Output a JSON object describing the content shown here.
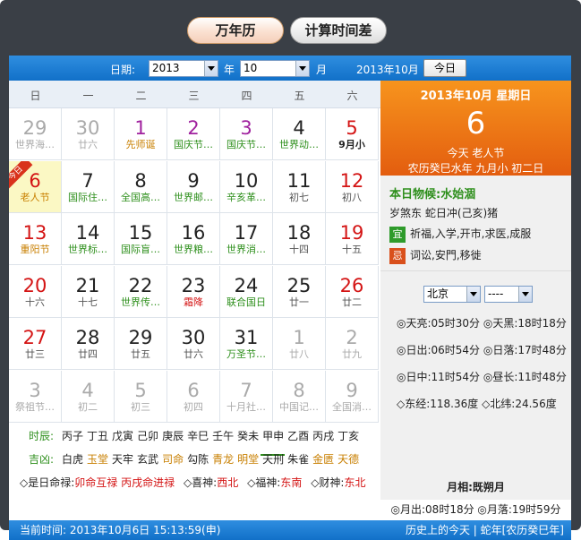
{
  "tabs": {
    "wannianli": "万年历",
    "jisuan": "计算时间差"
  },
  "toolbar": {
    "date_label": "日期:",
    "year_value": "2013",
    "year_unit": "年",
    "month_value": "10",
    "month_unit": "月",
    "current_label": "2013年10月",
    "today_button": "今日"
  },
  "weekdays": [
    "日",
    "一",
    "二",
    "三",
    "四",
    "五",
    "六"
  ],
  "rows": [
    [
      {
        "n": "29",
        "s": "世界海…",
        "c": "dim"
      },
      {
        "n": "30",
        "s": "廿六",
        "c": "dim"
      },
      {
        "n": "1",
        "s": "先师诞",
        "c": "fest",
        "red": 1
      },
      {
        "n": "2",
        "s": "国庆节…",
        "c": "nrm",
        "red": 1
      },
      {
        "n": "3",
        "s": "国庆节…",
        "c": "nrm",
        "red": 1
      },
      {
        "n": "4",
        "s": "世界动…",
        "c": "nrm"
      },
      {
        "n": "5",
        "s": "9月小",
        "c": "wkd bold"
      }
    ],
    [
      {
        "n": "6",
        "s": "老人节",
        "c": "wkd today fest"
      },
      {
        "n": "7",
        "s": "国际住…",
        "c": "nrm"
      },
      {
        "n": "8",
        "s": "全国高…",
        "c": "nrm"
      },
      {
        "n": "9",
        "s": "世界邮…",
        "c": "nrm"
      },
      {
        "n": "10",
        "s": "辛亥革…",
        "c": "nrm"
      },
      {
        "n": "11",
        "s": "初七",
        "c": "nrm lunar"
      },
      {
        "n": "12",
        "s": "初八",
        "c": "wkd lunar"
      }
    ],
    [
      {
        "n": "13",
        "s": "重阳节",
        "c": "wkd fest"
      },
      {
        "n": "14",
        "s": "世界标…",
        "c": "nrm"
      },
      {
        "n": "15",
        "s": "国际盲…",
        "c": "nrm"
      },
      {
        "n": "16",
        "s": "世界粮…",
        "c": "nrm"
      },
      {
        "n": "17",
        "s": "世界消…",
        "c": "nrm"
      },
      {
        "n": "18",
        "s": "十四",
        "c": "nrm lunar"
      },
      {
        "n": "19",
        "s": "十五",
        "c": "wkd lunar"
      }
    ],
    [
      {
        "n": "20",
        "s": "十六",
        "c": "wkd lunar"
      },
      {
        "n": "21",
        "s": "十七",
        "c": "nrm lunar"
      },
      {
        "n": "22",
        "s": "世界传…",
        "c": "nrm"
      },
      {
        "n": "23",
        "s": "霜降",
        "c": "nrm red"
      },
      {
        "n": "24",
        "s": "联合国日",
        "c": "nrm"
      },
      {
        "n": "25",
        "s": "廿一",
        "c": "nrm lunar"
      },
      {
        "n": "26",
        "s": "廿二",
        "c": "wkd lunar"
      }
    ],
    [
      {
        "n": "27",
        "s": "廿三",
        "c": "wkd lunar"
      },
      {
        "n": "28",
        "s": "廿四",
        "c": "nrm lunar"
      },
      {
        "n": "29",
        "s": "廿五",
        "c": "nrm lunar"
      },
      {
        "n": "30",
        "s": "廿六",
        "c": "nrm lunar"
      },
      {
        "n": "31",
        "s": "万圣节…",
        "c": "nrm"
      },
      {
        "n": "1",
        "s": "廿八",
        "c": "dim"
      },
      {
        "n": "2",
        "s": "廿九",
        "c": "dim"
      }
    ],
    [
      {
        "n": "3",
        "s": "祭祖节…",
        "c": "dim"
      },
      {
        "n": "4",
        "s": "初二",
        "c": "dim"
      },
      {
        "n": "5",
        "s": "初三",
        "c": "dim"
      },
      {
        "n": "6",
        "s": "初四",
        "c": "dim"
      },
      {
        "n": "7",
        "s": "十月社…",
        "c": "dim"
      },
      {
        "n": "8",
        "s": "中国记…",
        "c": "dim"
      },
      {
        "n": "9",
        "s": "全国消…",
        "c": "dim"
      }
    ]
  ],
  "today_ribbon": "今日",
  "shichen": {
    "label": "时辰:",
    "items": [
      "丙子",
      "丁丑",
      "戊寅",
      "己卯",
      "庚辰",
      "辛巳",
      "壬午",
      "癸未",
      "甲申",
      "乙酉",
      "丙戌",
      "丁亥"
    ]
  },
  "jixiong": {
    "label": "吉凶:",
    "items": [
      {
        "t": "白虎",
        "c": "black"
      },
      {
        "t": "玉堂",
        "c": "orange"
      },
      {
        "t": "天牢",
        "c": "black"
      },
      {
        "t": "玄武",
        "c": "black"
      },
      {
        "t": "司命",
        "c": "orange"
      },
      {
        "t": "勾陈",
        "c": "black"
      },
      {
        "t": "青龙",
        "c": "orange"
      },
      {
        "t": "明堂",
        "c": "orange"
      },
      {
        "t": "天刑",
        "c": "black"
      },
      {
        "t": "朱雀",
        "c": "black"
      },
      {
        "t": "金匮",
        "c": "orange"
      },
      {
        "t": "天德",
        "c": "orange"
      }
    ]
  },
  "shenwei": {
    "a": "◇是日命禄:",
    "b": "卯命互禄 丙戌命进禄",
    "c": "◇喜神:",
    "d": "西北",
    "e": "◇福神:",
    "f": "东南",
    "g": "◇财神:",
    "h": "东北"
  },
  "side": {
    "date": "2013年10月 星期日",
    "day": "6",
    "fest": "今天 老人节",
    "lunar": "农历癸巳水年 九月小 初二日",
    "wuhou": "本日物候:水始涸",
    "sha": "岁煞东  蛇日冲(己亥)猪",
    "yi_tag": "宜",
    "yi": "祈福,入学,开市,求医,成服",
    "ji_tag": "忌",
    "ji": "词讼,安門,移徙",
    "city": "北京",
    "district": "----",
    "tianliang": "◎天亮:05时30分  ◎天黑:18时18分",
    "richu": "◎日出:06时54分  ◎日落:17时48分",
    "rizhong": "◎日中:11时54分  ◎昼长:11时48分",
    "jingwei": "◇东经:118.36度  ◇北纬:24.56度",
    "moonphase": "月相:既朔月",
    "moontime": "◎月出:08时18分  ◎月落:19时59分"
  },
  "status": {
    "left": "当前时间: 2013年10月6日 15:13:59(申)",
    "right": "历史上的今天 | 蛇年[农历癸巳年]"
  }
}
